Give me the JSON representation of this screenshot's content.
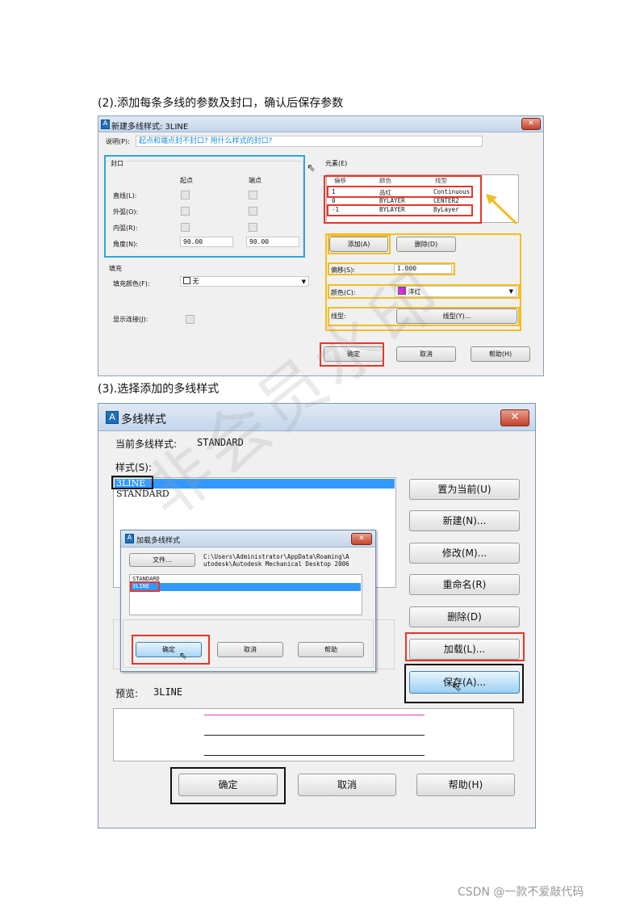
{
  "steps": {
    "step2": "(2).添加每条多线的参数及封口，确认后保存参数",
    "step3": "(3).选择添加的多线样式"
  },
  "dialog1": {
    "title": "新建多线样式: 3LINE",
    "desc_label": "说明(P):",
    "desc_value": "起点和端点封不封口? 用什么样式的封口?",
    "caps": {
      "group": "封口",
      "col_start": "起点",
      "col_end": "端点",
      "rows": [
        "直线(L):",
        "外弧(O):",
        "内弧(R):",
        "角度(N):"
      ],
      "angle_start": "90.00",
      "angle_end": "90.00"
    },
    "fill": {
      "group": "填充",
      "label": "填充颜色(F):",
      "value": "无"
    },
    "joints_label": "显示连接(J):",
    "elements": {
      "group": "元素(E)",
      "headers": [
        "偏移",
        "颜色",
        "线型"
      ],
      "rows": [
        {
          "offset": "1",
          "color": "品红",
          "linetype": "Continuous"
        },
        {
          "offset": "0",
          "color": "BYLAYER",
          "linetype": "CENTER2"
        },
        {
          "offset": "-1",
          "color": "BYLAYER",
          "linetype": "ByLayer"
        }
      ]
    },
    "add": "添加(A)",
    "delete": "删除(D)",
    "offset_label": "偏移(S):",
    "offset_value": "1.000",
    "color_label": "颜色(C):",
    "color_value": "洋红",
    "color_swatch": "#e020e0",
    "linetype_label": "线型:",
    "linetype_btn": "线型(Y)...",
    "ok": "确定",
    "cancel": "取消",
    "help": "帮助(H)"
  },
  "dialog2": {
    "title": "多线样式",
    "current_label": "当前多线样式:",
    "current_value": "STANDARD",
    "styles_label": "样式(S):",
    "styles": [
      "3LINE",
      "STANDARD"
    ],
    "preview_label": "预览:",
    "preview_value": "3LINE",
    "buttons": [
      "置为当前(U)",
      "新建(N)...",
      "修改(M)...",
      "重命名(R)",
      "删除(D)",
      "加载(L)...",
      "保存(A)..."
    ],
    "ok": "确定",
    "cancel": "取消",
    "help": "帮助(H)",
    "preview_colors": [
      "#e040c0",
      "#222222",
      "#222222"
    ]
  },
  "dialog3": {
    "title": "加载多线样式",
    "file_btn": "文件...",
    "path": "C:\\Users\\Administrator\\AppData\\Roaming\\Autodesk\\Autodesk Mechanical Desktop 2006",
    "path_line1": "C:\\Users\\Administrator\\AppData\\Roaming\\A",
    "path_line2": "utodesk\\Autodesk Mechanical Desktop 2006",
    "items": [
      "STANDARD",
      "3LINE"
    ],
    "ok": "确定",
    "cancel": "取消",
    "help": "帮助"
  },
  "watermark": "非会员水印",
  "footer": "CSDN @一款不爱敲代码",
  "colors": {
    "red": "#e8352a",
    "blue": "#2aa8e0",
    "yellow": "#f5bd1f",
    "black": "#111111",
    "highlight": "#3399ff"
  }
}
